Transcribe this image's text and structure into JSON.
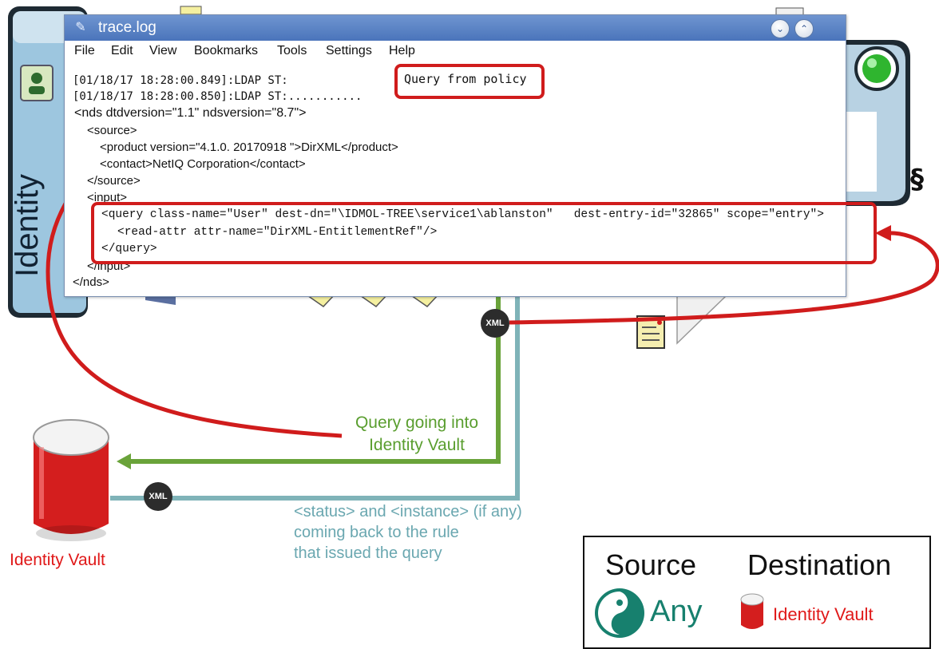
{
  "window": {
    "title": "trace.log",
    "menu": [
      "File",
      "Edit",
      "View",
      "Bookmarks",
      "Tools",
      "Settings",
      "Help"
    ]
  },
  "log": {
    "line1": "[01/18/17 18:28:00.849]:LDAP ST:",
    "line2": "[01/18/17 18:28:00.850]:LDAP ST:...........",
    "nds_open": "<nds dtdversion=\"1.1\" ndsversion=\"8.7\">",
    "source_open": "<source>",
    "product": "<product version=\"4.1.0. 20170918 \">DirXML</product>",
    "contact": "<contact>NetIQ Corporation</contact>",
    "source_close": "</source>",
    "input_open": "<input>",
    "query_open": "<query class-name=\"User\" dest-dn=\"\\IDMOL-TREE\\service1\\ablanston\"   dest-entry-id=\"32865\" scope=\"entry\">",
    "read_attr": "<read-attr attr-name=\"DirXML-EntitlementRef\"/>",
    "query_close": "</query>",
    "input_close": "</input>",
    "nds_close": "</nds>"
  },
  "callout": "Query from policy",
  "captions": {
    "query_into_vault": [
      "Query going into",
      "Identity Vault"
    ],
    "status_back": [
      "<status> and <instance> (if any)",
      "coming back to the rule",
      "that issued the query"
    ],
    "vault_label": "Identity Vault"
  },
  "badges": {
    "xml": "XML"
  },
  "side_panel": {
    "label": "Identity"
  },
  "legend": {
    "source_heading": "Source",
    "destination_heading": "Destination",
    "source_value": "Any",
    "destination_value": "Identity Vault"
  },
  "colors": {
    "highlight_red": "#d01c1c",
    "query_green": "#5a9e2f",
    "status_teal": "#6aa7b0",
    "vault_red": "#e01818",
    "any_teal": "#17806e"
  },
  "icons": [
    "address-book-icon",
    "green-status-light-icon",
    "link-icon",
    "document-icon",
    "database-icon",
    "source-any-icon"
  ]
}
